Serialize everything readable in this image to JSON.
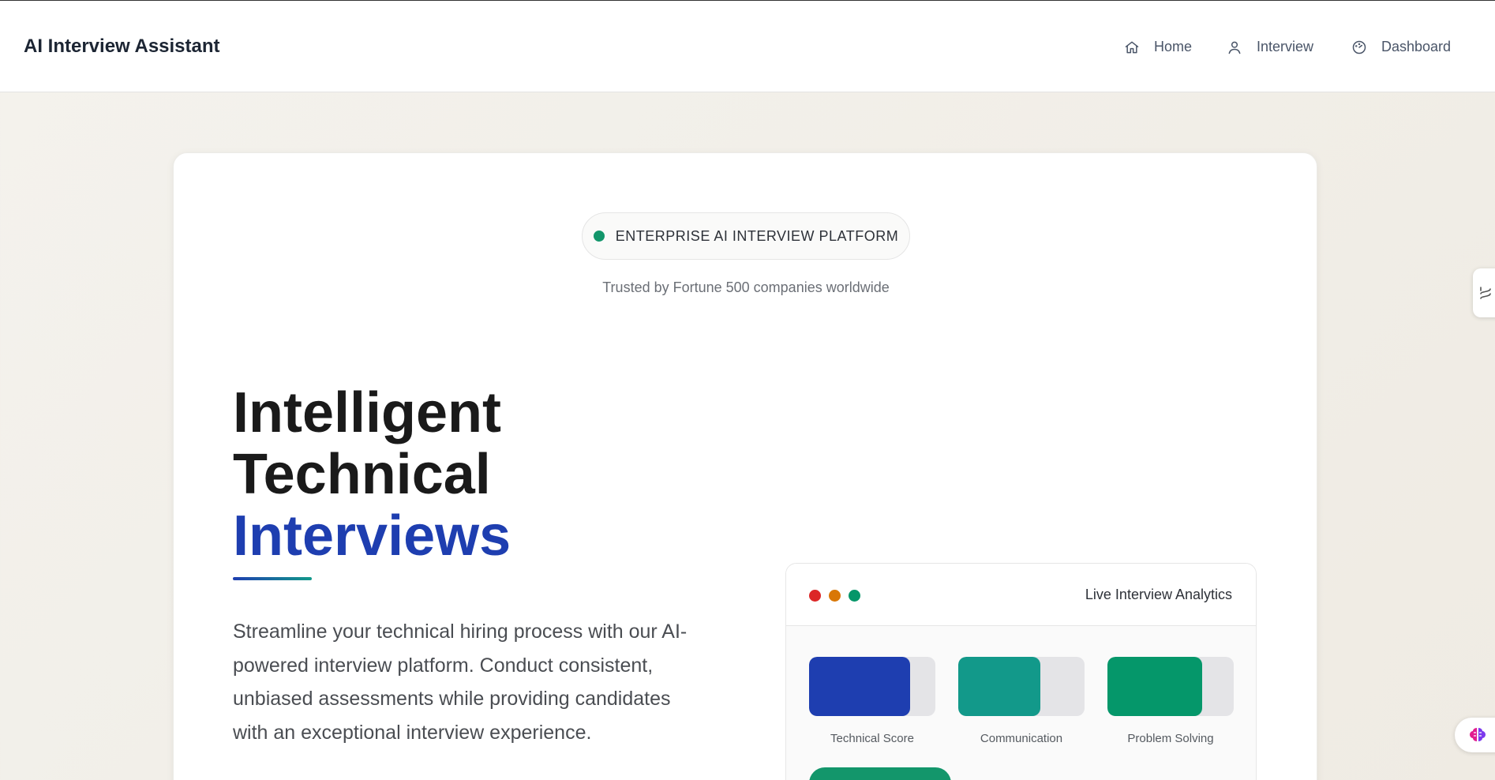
{
  "header": {
    "brand": "AI Interview Assistant",
    "nav": [
      {
        "label": "Home",
        "icon": "home-icon"
      },
      {
        "label": "Interview",
        "icon": "user-icon"
      },
      {
        "label": "Dashboard",
        "icon": "gauge-icon"
      }
    ]
  },
  "hero": {
    "badge": "ENTERPRISE AI INTERVIEW PLATFORM",
    "trusted": "Trusted by Fortune 500 companies worldwide",
    "title_line1": "Intelligent",
    "title_line2": "Technical",
    "title_accent": "Interviews",
    "description": "Streamline your technical hiring process with our AI-powered interview platform. Conduct consistent, unbiased assessments while providing candidates with an exceptional interview experience."
  },
  "analytics": {
    "title": "Live Interview Analytics",
    "metrics": [
      {
        "label": "Technical Score",
        "level": 0.8,
        "color": "#1e3eb0"
      },
      {
        "label": "Communication",
        "level": 0.65,
        "color": "#12998a"
      },
      {
        "label": "Problem Solving",
        "level": 0.75,
        "color": "#05976a"
      }
    ]
  },
  "colors": {
    "accent": "#1e3eb0",
    "teal": "#12998a",
    "green": "#13966b"
  }
}
